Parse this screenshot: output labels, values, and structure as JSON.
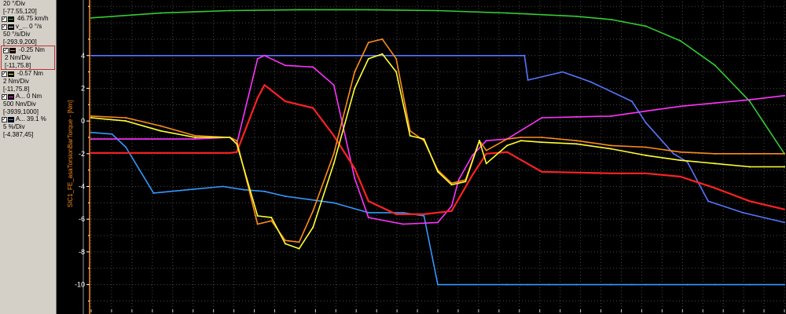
{
  "legend": {
    "top_partial": "20 °/Div",
    "top_range": "[-77.55,120]",
    "channels": [
      {
        "name": "",
        "value": "46.75 km/h",
        "color": "#33cc33",
        "lines": []
      },
      {
        "name": "v_...",
        "value": "0 °/s",
        "color": "#ffffff",
        "lines": [
          "50 °/s/Div",
          "[-293.9,200]"
        ]
      },
      {
        "name": "",
        "value": "-0.25 Nm",
        "color": "#ff8c1a",
        "lines": [
          "2 Nm/Div",
          "[-11,75.8]"
        ],
        "highlight": true
      },
      {
        "name": "",
        "value": "-0.57 Nm",
        "color": "#ffff33",
        "lines": [
          "2 Nm/Div",
          "[-11,75.8]"
        ]
      },
      {
        "name": "A...",
        "value": "0 Nm",
        "color": "#ff33ff",
        "lines": [
          "500 Nm/Div",
          "[-3939,1000]"
        ]
      },
      {
        "name": "A...",
        "value": "39.1 %",
        "color": "#3399ff",
        "lines": [
          "5 %/Div",
          "[-4.387,45]"
        ]
      }
    ]
  },
  "chart_data": {
    "type": "line",
    "ylabel": "SIC1_FE_asaTorsionBarTorque - [Nm]",
    "y_ticks": [
      4,
      2,
      0,
      -2,
      -4,
      -6,
      -8,
      -10
    ],
    "ylim": [
      -11.7,
      7.3
    ],
    "xlim": [
      0,
      100
    ],
    "grid": true,
    "series": [
      {
        "color": "#33cc33",
        "x": [
          0,
          10,
          20,
          30,
          40,
          50,
          60,
          70,
          75,
          80,
          85,
          90,
          95,
          100
        ],
        "y": [
          6.3,
          6.6,
          6.75,
          6.8,
          6.8,
          6.75,
          6.6,
          6.4,
          6.2,
          5.8,
          4.9,
          3.4,
          1.2,
          -2
        ]
      },
      {
        "color": "#3399ff",
        "x": [
          0,
          3,
          5,
          9,
          14,
          19,
          22,
          25,
          28,
          35,
          40,
          45,
          48,
          50,
          60,
          62,
          63,
          66,
          70,
          75,
          78,
          80,
          82,
          86,
          90,
          95,
          100
        ],
        "y": [
          -0.7,
          -0.8,
          -1.6,
          -4.4,
          -4.2,
          -4.0,
          -4.2,
          -4.3,
          -4.6,
          -5.0,
          -5.6,
          -5.6,
          -5.8,
          -10,
          -10,
          -10,
          -10,
          -10,
          -10,
          -10,
          -10,
          -10,
          -10,
          -10,
          -10,
          -10,
          -10
        ]
      },
      {
        "color": "#5577ff",
        "x": [
          0,
          62,
          62.5,
          63,
          68,
          72,
          78,
          80,
          84,
          86,
          89,
          94,
          100
        ],
        "y": [
          4,
          4,
          4,
          2.5,
          3,
          2.4,
          1.2,
          -0.1,
          -2.0,
          -2.5,
          -4.9,
          -5.6,
          -6.2
        ]
      },
      {
        "color": "#ff33ff",
        "x": [
          0,
          8,
          15,
          20,
          21,
          24,
          25,
          28,
          32,
          35,
          38,
          40,
          45,
          50,
          52,
          53,
          55,
          57,
          60,
          65,
          70,
          75,
          80,
          85,
          90,
          95,
          100
        ],
        "y": [
          -1.1,
          -1.1,
          -1.1,
          -1.0,
          -1.4,
          3.8,
          4.0,
          3.4,
          3.3,
          2.2,
          -3.5,
          -5.9,
          -6.3,
          -6.2,
          -5.2,
          -3.6,
          -2.1,
          -1.2,
          -1.1,
          0.2,
          0.25,
          0.3,
          0.6,
          0.9,
          1.1,
          1.3,
          1.55
        ]
      },
      {
        "color": "#ff2222",
        "x": [
          0,
          20,
          21,
          24,
          25,
          28,
          32,
          35,
          38,
          40,
          44,
          48,
          52,
          55,
          57,
          60,
          65,
          70,
          75,
          80,
          85,
          90,
          95,
          100
        ],
        "y": [
          -1.95,
          -1.95,
          -1.9,
          1.4,
          2.2,
          1.2,
          0.8,
          -0.9,
          -2.9,
          -4.9,
          -5.7,
          -5.7,
          -5.5,
          -3.3,
          -2.0,
          -1.9,
          -3.1,
          -3.15,
          -3.2,
          -3.2,
          -3.4,
          -4.1,
          -4.9,
          -5.4
        ]
      },
      {
        "color": "#ff8c1a",
        "x": [
          0,
          5,
          10,
          15,
          20,
          21,
          24,
          26,
          28,
          30,
          32,
          35,
          38,
          40,
          42,
          44,
          46,
          48,
          50,
          52,
          54,
          56,
          57,
          60,
          62,
          65,
          70,
          75,
          80,
          85,
          90,
          95,
          100
        ],
        "y": [
          0.3,
          0.2,
          -0.3,
          -0.9,
          -1.0,
          -1.2,
          -6.3,
          -6.1,
          -7.3,
          -7.4,
          -5.5,
          -2.0,
          3.0,
          4.8,
          5.0,
          3.8,
          -0.6,
          -1.2,
          -3.0,
          -3.8,
          -3.6,
          -1.2,
          -1.8,
          -1.1,
          -1.0,
          -1.0,
          -1.2,
          -1.5,
          -1.6,
          -1.9,
          -2.0,
          -2.0,
          -2.0
        ]
      },
      {
        "color": "#ffff33",
        "x": [
          0,
          5,
          10,
          15,
          20,
          21,
          24,
          26,
          28,
          30,
          32,
          35,
          38,
          40,
          42,
          44,
          46,
          48,
          50,
          52,
          54,
          56,
          57,
          60,
          62,
          65,
          70,
          75,
          80,
          85,
          90,
          95,
          100
        ],
        "y": [
          0.2,
          0.0,
          -0.6,
          -1.0,
          -1.0,
          -1.4,
          -5.8,
          -5.9,
          -7.5,
          -7.8,
          -6.5,
          -2.6,
          2.0,
          3.8,
          4.1,
          3.0,
          -0.9,
          -1.1,
          -3.1,
          -3.9,
          -3.7,
          -1.2,
          -2.6,
          -1.5,
          -1.2,
          -1.3,
          -1.4,
          -1.7,
          -2.1,
          -2.4,
          -2.6,
          -2.8,
          -2.8
        ]
      }
    ]
  }
}
